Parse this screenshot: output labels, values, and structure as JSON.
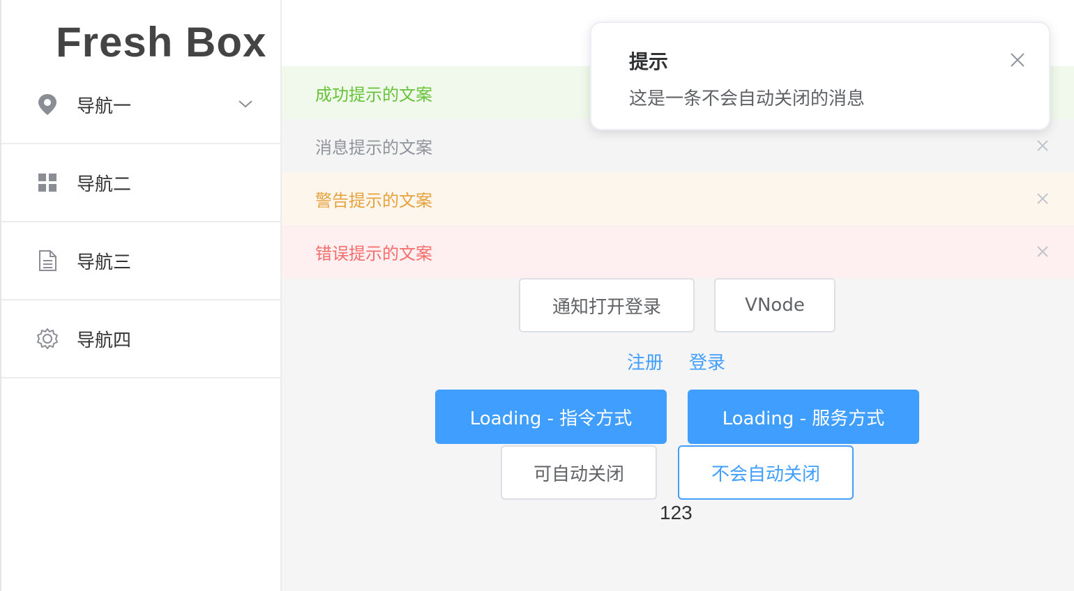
{
  "app": {
    "logo_text": "Fresh Box"
  },
  "sidebar": {
    "items": [
      {
        "label": "导航一",
        "icon": "location-pin-icon",
        "has_submenu": true
      },
      {
        "label": "导航二",
        "icon": "grid-menu-icon"
      },
      {
        "label": "导航三",
        "icon": "document-icon"
      },
      {
        "label": "导航四",
        "icon": "gear-icon"
      }
    ]
  },
  "alerts": {
    "success": "成功提示的文案",
    "info": "消息提示的文案",
    "warning": "警告提示的文案",
    "error": "错误提示的文案"
  },
  "buttons": {
    "notify_open_login": "通知打开登录",
    "vnode": "VNode",
    "loading_directive": "Loading - 指令方式",
    "loading_service": "Loading - 服务方式",
    "auto_close": "可自动关闭",
    "no_auto_close": "不会自动关闭"
  },
  "links": {
    "register": "注册",
    "login": "登录"
  },
  "counter": "123",
  "notification": {
    "title": "提示",
    "message": "这是一条不会自动关闭的消息"
  },
  "colors": {
    "primary": "#409eff",
    "success": "#67c23a",
    "info": "#909399",
    "warning": "#e6a23c",
    "error": "#f56c6c"
  }
}
